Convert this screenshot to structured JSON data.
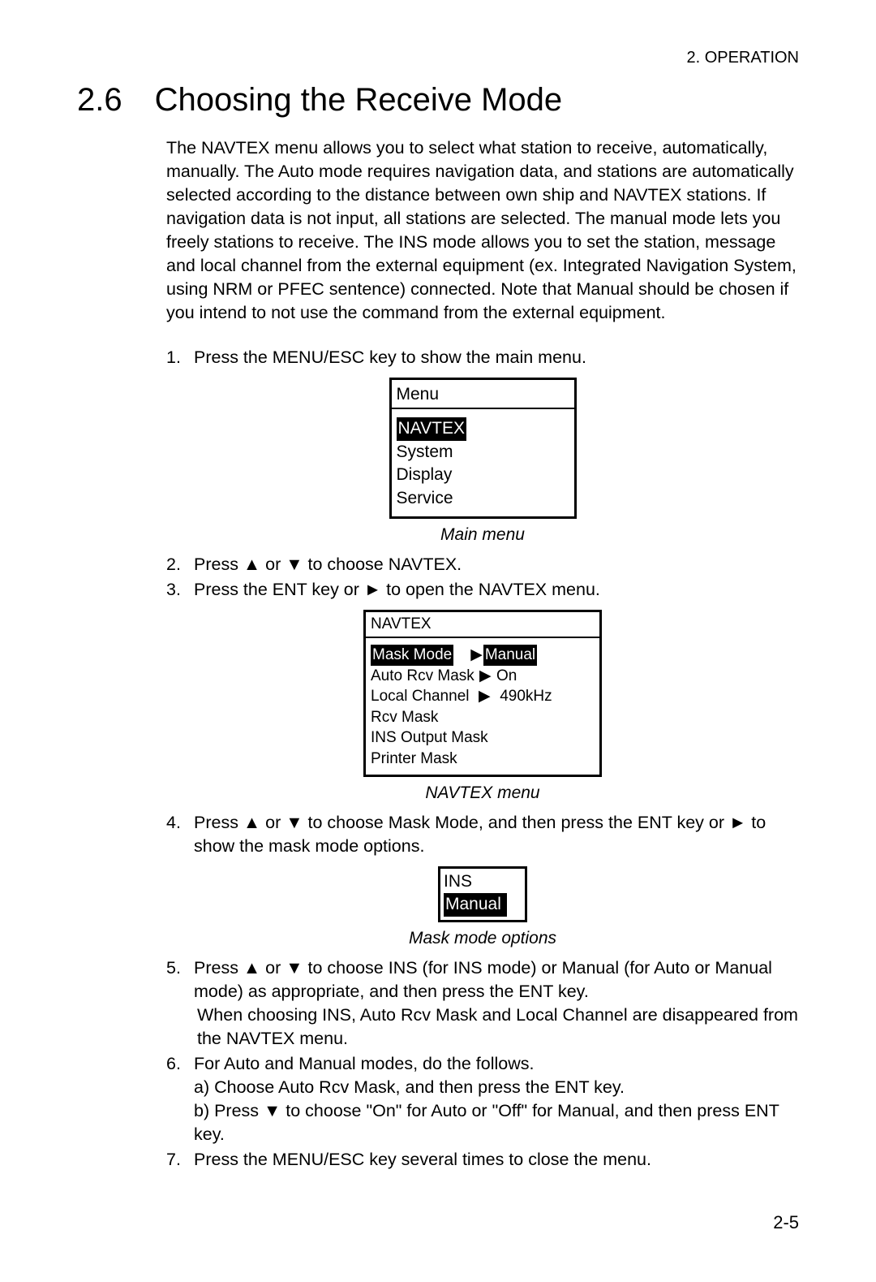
{
  "header": "2. OPERATION",
  "section_number": "2.6",
  "section_title": "Choosing the Receive Mode",
  "intro": "The NAVTEX menu allows you to select what station to receive, automatically, manually. The Auto mode requires navigation data, and stations are automatically selected according to the distance between own ship and NAVTEX stations. If navigation data is not input, all stations are selected. The manual mode lets you freely stations to receive. The INS mode allows you to set the station, message and local channel from the external equipment (ex. Integrated Navigation System, using NRM or PFEC sentence) connected. Note that Manual should be chosen if you intend to not use the command from the external equipment.",
  "steps": {
    "s1": {
      "marker": "1.",
      "text": "Press the MENU/ESC key to show the main menu."
    },
    "s2": {
      "marker": "2.",
      "text": "Press ▲ or ▼ to choose NAVTEX."
    },
    "s3": {
      "marker": "3.",
      "text": "Press the ENT key or ► to open the NAVTEX menu."
    },
    "s4": {
      "marker": "4.",
      "text": "Press ▲ or ▼ to choose Mask Mode, and then press the ENT key or ► to show the mask mode options."
    },
    "s5": {
      "marker": "5.",
      "text": "Press ▲ or ▼ to choose INS (for INS mode) or Manual (for Auto or Manual mode) as appropriate, and then press the ENT key.",
      "extra": "When choosing INS, Auto Rcv Mask and Local Channel are disappeared from the NAVTEX menu."
    },
    "s6": {
      "marker": "6.",
      "text": "For Auto and Manual modes, do the follows.",
      "a": "a) Choose Auto Rcv Mask, and then press the ENT key.",
      "b": "b) Press ▼ to choose \"On\" for Auto or \"Off\" for Manual, and then press ENT key."
    },
    "s7": {
      "marker": "7.",
      "text": "Press the MENU/ESC key several times to close the menu."
    }
  },
  "main_menu": {
    "title": "Menu",
    "items": [
      "NAVTEX",
      "System",
      "Display",
      "Service"
    ],
    "caption": "Main menu"
  },
  "navtex_menu": {
    "title": "NAVTEX",
    "rows": {
      "r0": {
        "label": "Mask Mode",
        "arrow": "▶",
        "value": "Manual"
      },
      "r1": {
        "label": "Auto Rcv Mask",
        "arrow": "▶",
        "value": "On"
      },
      "r2": {
        "label": "Local Channel",
        "arrow": "▶",
        "value": "490kHz"
      },
      "r3": {
        "label": "Rcv Mask"
      },
      "r4": {
        "label": "INS Output Mask"
      },
      "r5": {
        "label": "Printer Mask"
      }
    },
    "caption": "NAVTEX menu"
  },
  "mask_options": {
    "items": [
      "INS",
      "Manual"
    ],
    "caption": "Mask mode options"
  },
  "page_number": "2-5"
}
